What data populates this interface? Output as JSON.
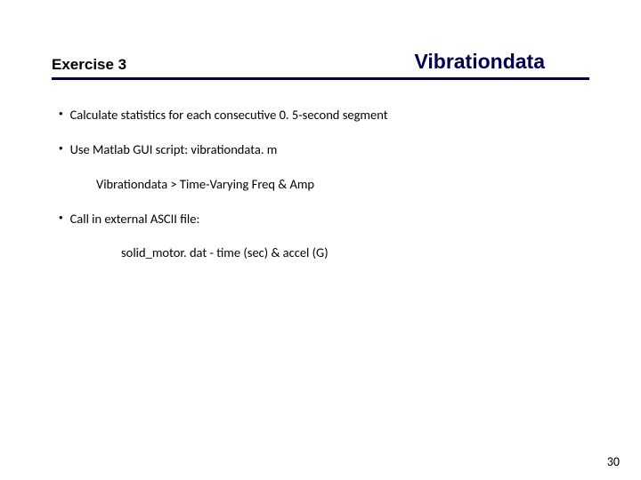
{
  "header": {
    "left": "Exercise 3",
    "right": "Vibrationdata"
  },
  "bullets": {
    "b1": "Calculate statistics for each consecutive 0. 5-second segment",
    "b2": "Use Matlab GUI script:  vibrationdata. m",
    "b2_sub": "Vibrationdata > Time-Varying Freq & Amp",
    "b3": "Call in external ASCII file:",
    "b3_sub": "solid_motor. dat    -   time (sec) & accel (G)"
  },
  "page_number": "30"
}
